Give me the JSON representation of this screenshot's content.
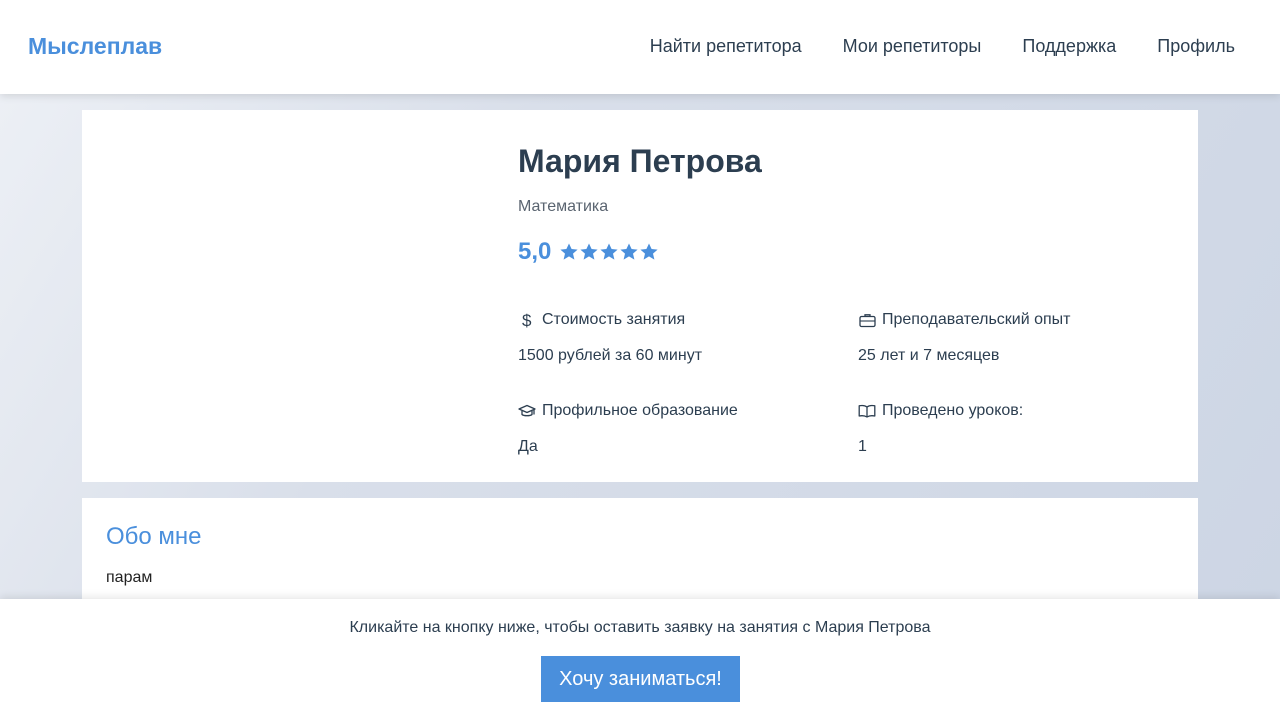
{
  "header": {
    "brand": "Мыслеплав",
    "nav": [
      "Найти репетитора",
      "Мои репетиторы",
      "Поддержка",
      "Профиль"
    ]
  },
  "tutor": {
    "name": "Мария Петрова",
    "subject": "Математика",
    "rating": "5,0",
    "stars": 5,
    "star_color": "#4a8fdc"
  },
  "info": {
    "price_label": "Стоимость занятия",
    "price_value": "1500 рублей за 60 минут",
    "experience_label": "Преподавательский опыт",
    "experience_value": "25 лет и 7 месяцев",
    "education_label": "Профильное образование",
    "education_value": "Да",
    "lessons_label": "Проведено уроков:",
    "lessons_value": "1"
  },
  "about": {
    "title": "Обо мне",
    "text": "парам"
  },
  "footer": {
    "prompt": "Кликайте на кнопку ниже, чтобы оставить заявку на занятия с Мария Петрова",
    "button": "Хочу заниматься!"
  },
  "colors": {
    "accent": "#4a8fdc",
    "text": "#2c3e50"
  }
}
